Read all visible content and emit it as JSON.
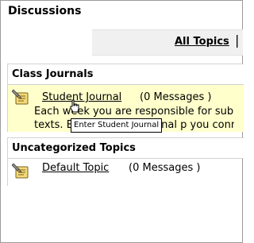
{
  "page": {
    "title": "Discussions"
  },
  "toolbar": {
    "all_topics_label": "All Topics",
    "separator": "|"
  },
  "sections": [
    {
      "title": "Class Journals",
      "topics": [
        {
          "name": "Student Journal",
          "messages": "(0 Messages )",
          "description_line1": "Each week you are responsible for subm",
          "description_line2": "texts. Enter Student Journal p you connect th"
        }
      ]
    },
    {
      "title": "Uncategorized Topics",
      "topics": [
        {
          "name": "Default Topic",
          "messages": "(0 Messages )"
        }
      ]
    }
  ],
  "tooltip": {
    "text": "Enter Student Journal"
  },
  "icons": {
    "topic": "discussion-topic-icon",
    "cursor": "hand-pointer-cursor-icon"
  },
  "colors": {
    "highlight": "#ffffcc",
    "toolbar_bg": "#f0f0f0",
    "border": "#d2d2d2"
  }
}
